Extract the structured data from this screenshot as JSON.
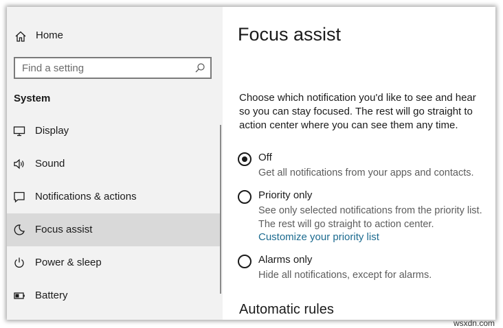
{
  "sidebar": {
    "home_label": "Home",
    "search_placeholder": "Find a setting",
    "section_title": "System",
    "items": [
      {
        "label": "Display",
        "icon": "monitor-icon"
      },
      {
        "label": "Sound",
        "icon": "speaker-icon"
      },
      {
        "label": "Notifications & actions",
        "icon": "message-icon"
      },
      {
        "label": "Focus assist",
        "icon": "moon-icon",
        "selected": true
      },
      {
        "label": "Power & sleep",
        "icon": "power-icon"
      },
      {
        "label": "Battery",
        "icon": "battery-icon"
      }
    ]
  },
  "main": {
    "title": "Focus assist",
    "description": "Choose which notification you'd like to see and hear so you can stay focused. The rest will go straight to action center where you can see them any time.",
    "options": [
      {
        "label": "Off",
        "description": "Get all notifications from your apps and contacts.",
        "checked": true
      },
      {
        "label": "Priority only",
        "description": "See only selected notifications from the priority list. The rest will go straight to action center.",
        "link": "Customize your priority list",
        "checked": false
      },
      {
        "label": "Alarms only",
        "description": "Hide all notifications, except for alarms.",
        "checked": false
      }
    ],
    "automatic_rules_heading": "Automatic rules"
  },
  "watermark": {
    "site": "wsxdn.com"
  },
  "colors": {
    "sidebar_bg": "#f2f2f2",
    "selected_bg": "#d9d9d9",
    "link": "#1b6a8f"
  }
}
